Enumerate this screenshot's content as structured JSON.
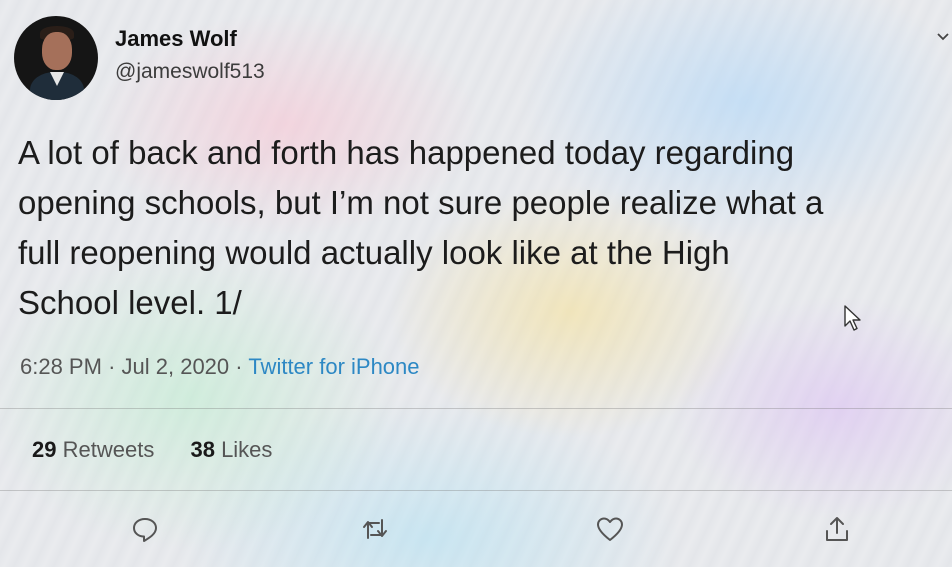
{
  "author": {
    "name": "James Wolf",
    "handle": "@jameswolf513",
    "avatar_icon": "user-avatar"
  },
  "tweet": {
    "lines": [
      "A lot of back and forth has happened today regarding",
      "opening schools, but I’m not sure people realize what a",
      "full reopening would actually look like at the High",
      "School level. 1/"
    ]
  },
  "meta": {
    "time": "6:28 PM",
    "sep1": "·",
    "date": "Jul 2, 2020",
    "sep2": "·",
    "source": "Twitter for iPhone"
  },
  "stats": {
    "retweets_count": "29",
    "retweets_label": "Retweets",
    "likes_count": "38",
    "likes_label": "Likes"
  },
  "actions": {
    "reply_icon": "reply-icon",
    "retweet_icon": "retweet-icon",
    "like_icon": "heart-icon",
    "share_icon": "share-icon"
  },
  "colors": {
    "link": "#2d88c4",
    "text": "#1c1c1c",
    "secondary": "#555555"
  }
}
